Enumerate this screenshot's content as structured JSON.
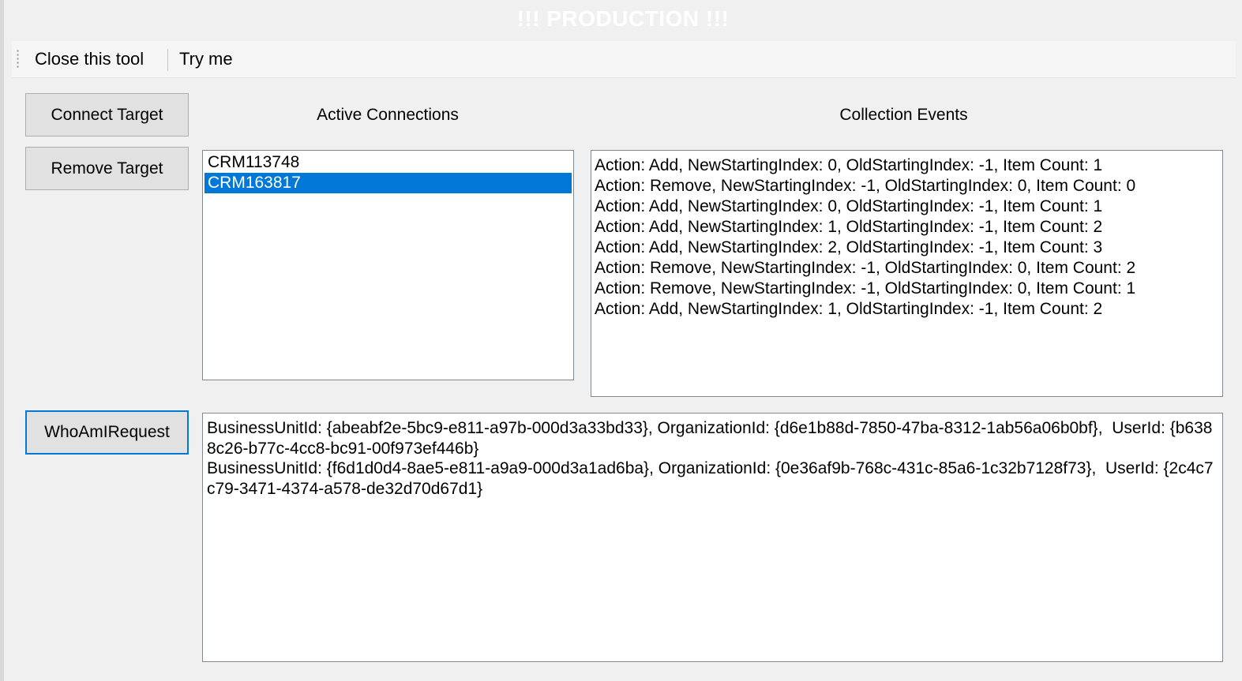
{
  "window": {
    "title": "!!! PRODUCTION !!!"
  },
  "toolbar": {
    "close_label": "Close this tool",
    "try_label": "Try me"
  },
  "buttons": {
    "connect_label": "Connect Target",
    "remove_label": "Remove Target",
    "whoami_label": "WhoAmIRequest"
  },
  "labels": {
    "active_connections": "Active Connections",
    "collection_events": "Collection Events"
  },
  "connections": {
    "items": [
      "CRM113748",
      "CRM163817"
    ],
    "selected_index": 1
  },
  "events": [
    "Action: Add, NewStartingIndex: 0, OldStartingIndex: -1, Item Count: 1",
    "Action: Remove, NewStartingIndex: -1, OldStartingIndex: 0, Item Count: 0",
    "Action: Add, NewStartingIndex: 0, OldStartingIndex: -1, Item Count: 1",
    "Action: Add, NewStartingIndex: 1, OldStartingIndex: -1, Item Count: 2",
    "Action: Add, NewStartingIndex: 2, OldStartingIndex: -1, Item Count: 3",
    "Action: Remove, NewStartingIndex: -1, OldStartingIndex: 0, Item Count: 2",
    "Action: Remove, NewStartingIndex: -1, OldStartingIndex: 0, Item Count: 1",
    "Action: Add, NewStartingIndex: 1, OldStartingIndex: -1, Item Count: 2"
  ],
  "whoami": {
    "results": [
      "BusinessUnitId: {abeabf2e-5bc9-e811-a97b-000d3a33bd33}, OrganizationId: {d6e1b88d-7850-47ba-8312-1ab56a06b0bf},  UserId: {b6388c26-b77c-4cc8-bc91-00f973ef446b}",
      "BusinessUnitId: {f6d1d0d4-8ae5-e811-a9a9-000d3a1ad6ba}, OrganizationId: {0e36af9b-768c-431c-85a6-1c32b7128f73},  UserId: {2c4c7c79-3471-4374-a578-de32d70d67d1}"
    ]
  },
  "colors": {
    "selection": "#0078d7",
    "focus_border": "#0078d7",
    "title_text": "#ffffff"
  }
}
